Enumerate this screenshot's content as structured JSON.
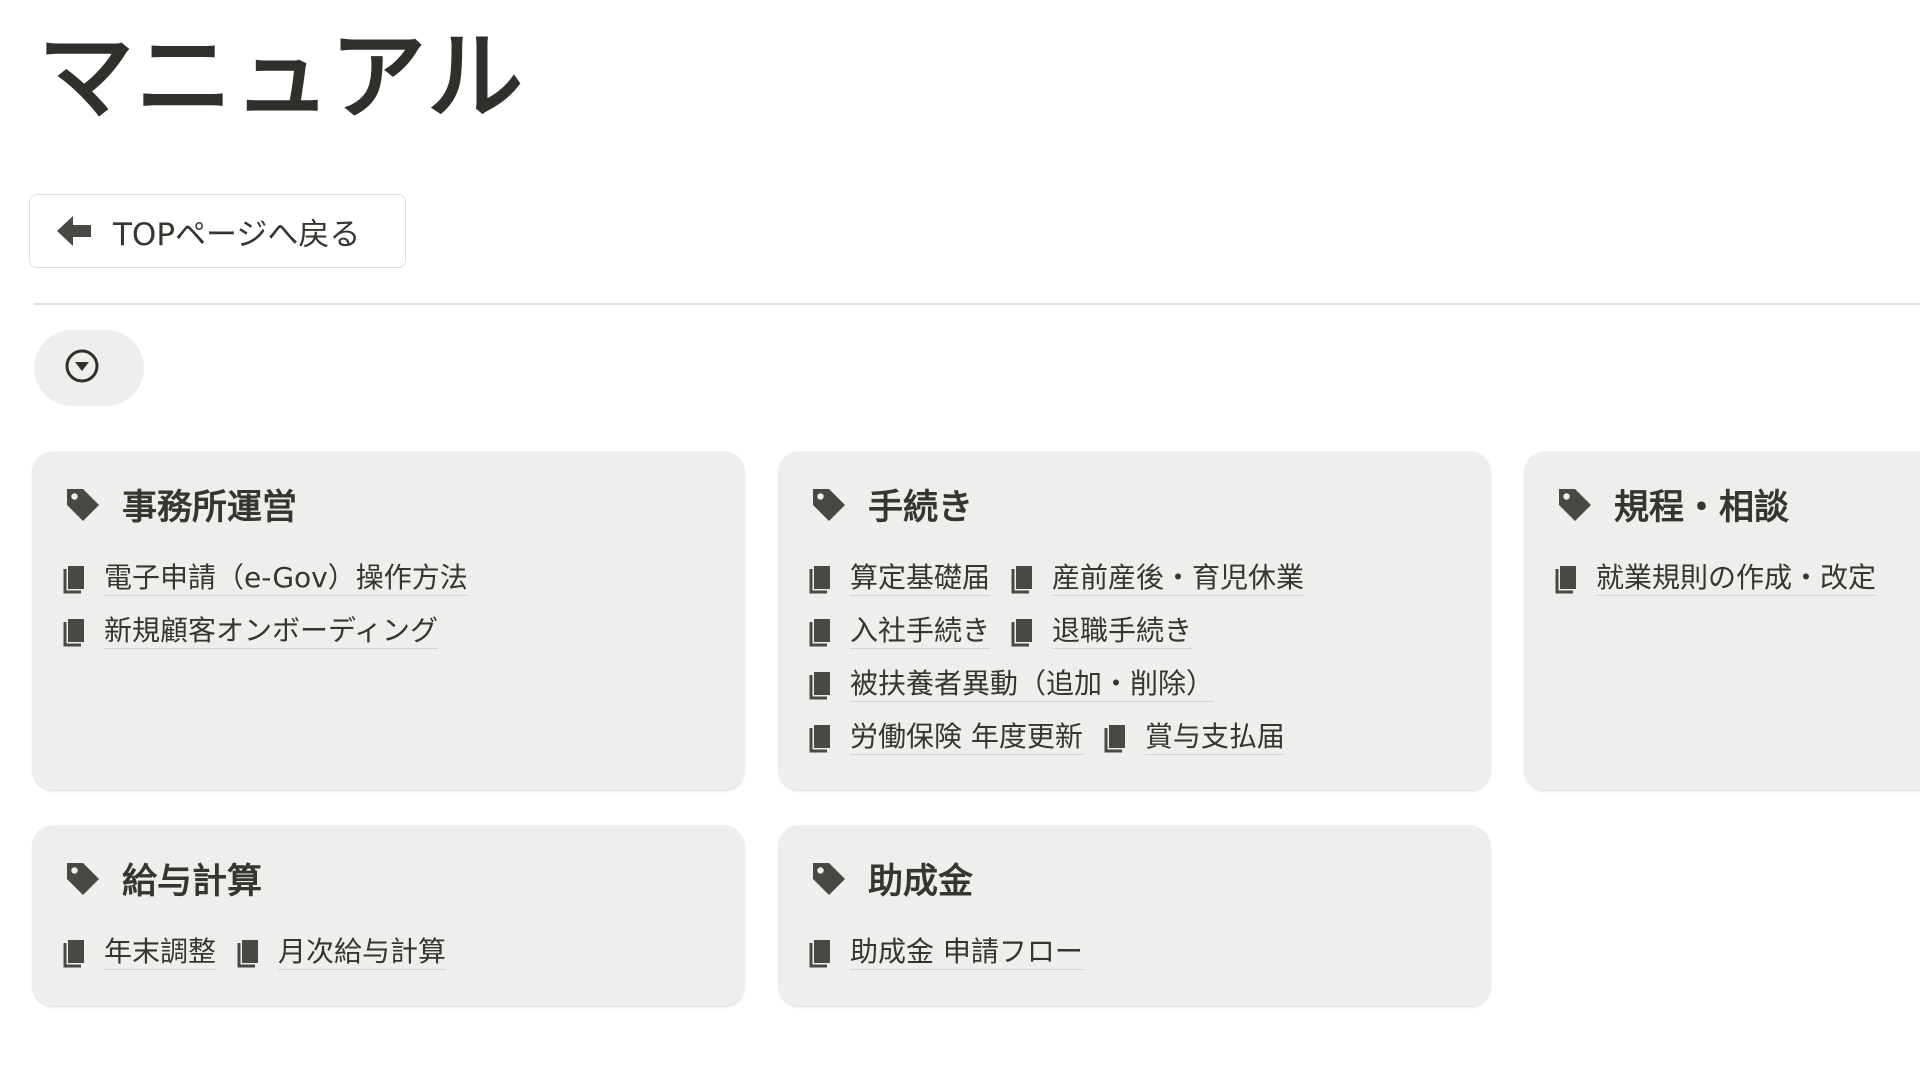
{
  "page": {
    "title": "マニュアル"
  },
  "back_button": {
    "label": "TOPページへ戻る",
    "icon": "arrow-left-icon"
  },
  "filter_button": {
    "icon": "chevron-down-circle-icon"
  },
  "icons": {
    "card": "tag-icon",
    "link": "document-icon"
  },
  "colors": {
    "card_bg": "#efeeec",
    "text": "#37352f",
    "icon": "#4a4845"
  },
  "cards": [
    {
      "title": "事務所運営",
      "lines": [
        [
          "電子申請（e-Gov）操作方法"
        ],
        [
          "新規顧客オンボーディング"
        ]
      ]
    },
    {
      "title": "手続き",
      "lines": [
        [
          "算定基礎届",
          "産前産後・育児休業"
        ],
        [
          "入社手続き",
          "退職手続き"
        ],
        [
          "被扶養者異動（追加・削除）"
        ],
        [
          "労働保険 年度更新",
          "賞与支払届"
        ]
      ]
    },
    {
      "title": "規程・相談",
      "lines": [
        [
          "就業規則の作成・改定"
        ]
      ]
    },
    {
      "title": "給与計算",
      "lines": [
        [
          "年末調整",
          "月次給与計算"
        ]
      ]
    },
    {
      "title": "助成金",
      "lines": [
        [
          "助成金 申請フロー"
        ]
      ]
    }
  ]
}
